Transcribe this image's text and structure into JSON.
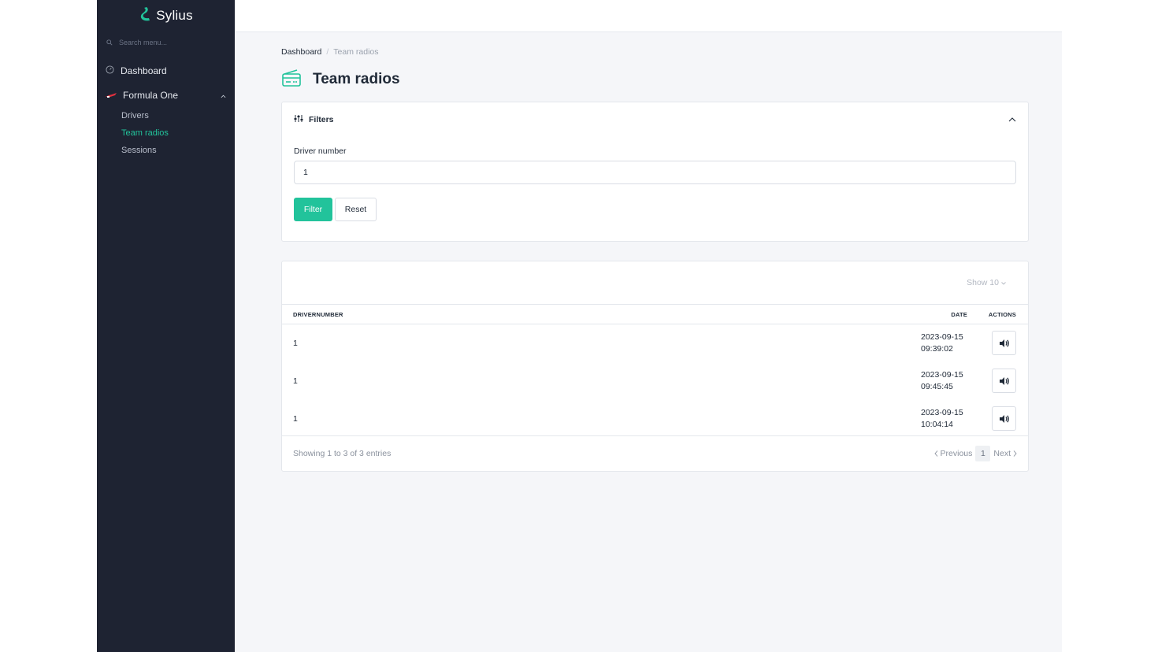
{
  "brand": {
    "name": "Sylius"
  },
  "sidebar": {
    "search_placeholder": "Search menu...",
    "items": [
      {
        "label": "Dashboard",
        "icon": "dashboard-icon"
      },
      {
        "label": "Formula One",
        "icon": "f1-car-icon",
        "expanded": true,
        "children": [
          {
            "label": "Drivers",
            "active": false
          },
          {
            "label": "Team radios",
            "active": true
          },
          {
            "label": "Sessions",
            "active": false
          }
        ]
      }
    ]
  },
  "breadcrumb": {
    "home": "Dashboard",
    "separator": "/",
    "current": "Team radios"
  },
  "page": {
    "title": "Team radios",
    "icon": "radio-icon"
  },
  "filters": {
    "title": "Filters",
    "driver_number_label": "Driver number",
    "driver_number_value": "1",
    "filter_button": "Filter",
    "reset_button": "Reset"
  },
  "table": {
    "show_label": "Show 10",
    "columns": {
      "driver": "DRIVERNUMBER",
      "date": "DATE",
      "actions": "ACTIONS"
    },
    "rows": [
      {
        "driver": "1",
        "date": "2023-09-15",
        "time": "09:39:02"
      },
      {
        "driver": "1",
        "date": "2023-09-15",
        "time": "09:45:45"
      },
      {
        "driver": "1",
        "date": "2023-09-15",
        "time": "10:04:14"
      }
    ],
    "summary": "Showing 1 to 3 of 3 entries",
    "pagination": {
      "previous": "Previous",
      "page": "1",
      "next": "Next"
    }
  },
  "colors": {
    "accent": "#22c39b",
    "sidebar_bg": "#1e2332",
    "content_bg": "#f5f6f9"
  }
}
